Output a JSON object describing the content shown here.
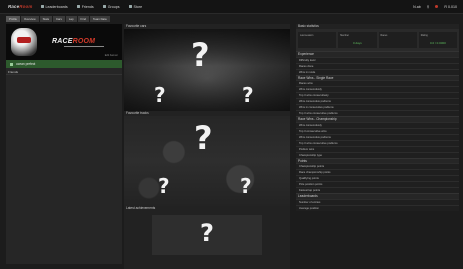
{
  "topbar": {
    "logo_main": "Race",
    "logo_accent": "Room",
    "nav": [
      "Leaderboards",
      "Friends",
      "Groups",
      "Store"
    ],
    "user_short": "N.ab",
    "action_label": "R 0.010"
  },
  "subnav": [
    "Profile",
    "Overview",
    "Stats",
    "Cars",
    "Lap",
    "Find",
    "Team Data"
  ],
  "profile": {
    "banner_logo_main": "RACE",
    "banner_logo_accent": "ROOM",
    "banner_link": "Edit banner",
    "name": "ocean prefect",
    "section_label": "Friends"
  },
  "middle": {
    "sec1": "Favourite cars",
    "sec2": "Favourite tracks",
    "sec3": "Latest achievements",
    "placeholder_glyph": "?"
  },
  "right": {
    "title": "Basic statistics",
    "stats": [
      {
        "label": "Last session",
        "value": ""
      },
      {
        "label": "Member",
        "value": "0 days"
      },
      {
        "label": "Races",
        "value": ""
      },
      {
        "label": "Rating",
        "value": "0.0 / 0.0000"
      }
    ],
    "groups": [
      {
        "header": "Experience",
        "rows": [
          "Difficulty level",
          "Races done",
          "Wins in mode"
        ]
      },
      {
        "header": "Race Wins - Single Race",
        "rows": [
          "Races wins",
          "Wins consecutively",
          "Top 3 wins consecutively",
          "Wins consecutive podiums",
          "Wins in consecutive podiums",
          "Top 3 wins consecutive podiums"
        ]
      },
      {
        "header": "Race Wins - Championship",
        "rows": [
          "Wins consecutively",
          "Top 3 consecutive wins",
          "Wins consecutive podiums",
          "Top 3 wins consecutive podiums",
          "Podium wins",
          "Championship type"
        ]
      },
      {
        "header": "Points",
        "rows": [
          "Championship points",
          "Race championship points",
          "Qualifying points",
          "Pole position points",
          "Fastest lap points"
        ]
      },
      {
        "header": "Leaderboards",
        "rows": [
          "Number of entries",
          "Average position"
        ]
      }
    ]
  }
}
